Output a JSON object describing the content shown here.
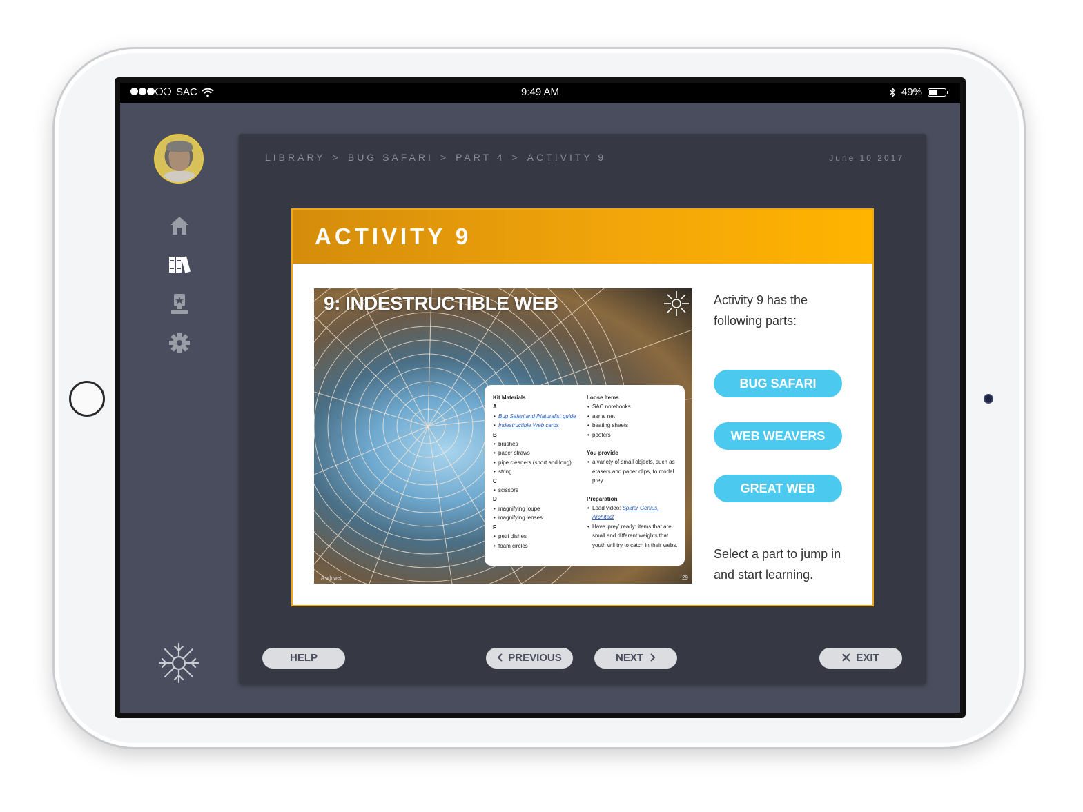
{
  "status_bar": {
    "carrier": "SAC",
    "time": "9:49 AM",
    "battery": "49%",
    "battery_level": 0.49
  },
  "sidebar": {
    "items": [
      {
        "icon": "home-icon"
      },
      {
        "icon": "library-icon"
      },
      {
        "icon": "award-icon"
      },
      {
        "icon": "gear-icon"
      }
    ]
  },
  "breadcrumb": [
    "LIBRARY",
    ">",
    "BUG SAFARI",
    ">",
    "PART 4",
    ">",
    "ACTIVITY 9"
  ],
  "date": "June 10 2017",
  "activity": {
    "title": "ACTIVITY 9",
    "image_title": "9: INDESTRUCTIBLE WEB",
    "image_credit": "A orb web",
    "image_page": "29",
    "materials": {
      "kit_heading": "Kit Materials",
      "kit": [
        {
          "label": "A",
          "items": [
            "Bug Safari and iNaturalist guide",
            "Indestructible Web cards"
          ],
          "links": true
        },
        {
          "label": "B",
          "items": [
            "brushes",
            "paper straws",
            "pipe cleaners (short and long)",
            "string"
          ]
        },
        {
          "label": "C",
          "items": [
            "scissors"
          ]
        },
        {
          "label": "D",
          "items": [
            "magnifying loupe",
            "magnifying lenses"
          ]
        },
        {
          "label": "F",
          "items": [
            "petri dishes",
            "foam circles"
          ]
        }
      ],
      "loose_heading": "Loose Items",
      "loose": [
        "SAC notebooks",
        "aerial net",
        "beating sheets",
        "pooters"
      ],
      "provide_heading": "You provide",
      "provide": [
        "a variety of small objects, such as erasers and paper clips, to model prey"
      ],
      "prep_heading": "Preparation",
      "prep_video_prefix": "Load video: ",
      "prep_video_link": "Spider Genius, Architect",
      "prep_other": "Have 'prey' ready: items that are small and different weights that youth will try to catch in their webs."
    },
    "intro": "Activity 9 has the following parts:",
    "parts": [
      "BUG SAFARI",
      "WEB WEAVERS",
      "GREAT WEB"
    ],
    "outro": "Select a part to jump in and start learning."
  },
  "controls": {
    "help": "HELP",
    "previous": "PREVIOUS",
    "next": "NEXT",
    "exit": "EXIT"
  },
  "colors": {
    "accent": "#f1a50a",
    "part_button": "#4cc9ee",
    "background": "#4a4d5d",
    "card": "#363944"
  }
}
